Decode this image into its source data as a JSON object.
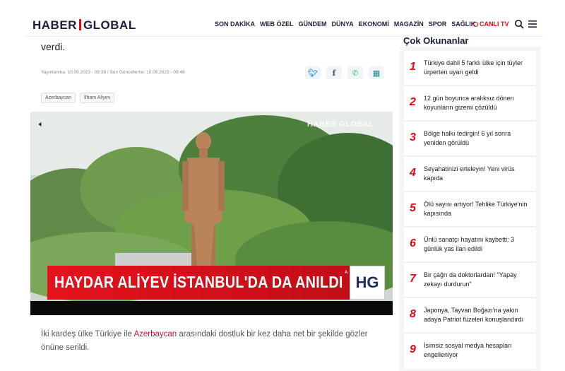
{
  "header": {
    "logo_left": "HABER",
    "logo_right": "GLOBAL",
    "nav": [
      "SON DAKİKA",
      "WEB ÖZEL",
      "GÜNDEM",
      "DÜNYA",
      "EKONOMİ",
      "MAGAZİN",
      "SPOR",
      "SAĞLIK"
    ],
    "live_label": "CANLI TV",
    "icons": [
      "search-icon",
      "menu-icon"
    ]
  },
  "article": {
    "lead_end": "verdi.",
    "meta": "Yayınlanma: 10.05.2023 - 09:38 / Son Güncelleme: 10.05.2023 - 09:46",
    "share_icons": [
      "twitter-icon",
      "facebook-icon",
      "whatsapp-icon",
      "calendar-icon"
    ],
    "tags": [
      "Azerbaycan",
      "İlham Aliyev"
    ],
    "video": {
      "watermark": "HABER GLOBAL",
      "banner": "HAYDAR ALİYEV İSTANBUL'DA DA ANILDI",
      "badge": "HG",
      "badge_small": "A"
    },
    "body_before": "İki kardeş ülke Türkiye ile ",
    "body_link": "Azerbaycan",
    "body_after": " arasındaki dostluk bir kez daha net bir şekilde gözler önüne serildi."
  },
  "sidebar": {
    "title": "Çok Okunanlar",
    "items": [
      {
        "num": "1",
        "text": "Türkiye dahil 5 farklı ülke için tüyler ürperten uyarı geldi"
      },
      {
        "num": "2",
        "text": "12 gün boyunca aralıksız dönen koyunların gizemi çözüldü"
      },
      {
        "num": "3",
        "text": "Bölge halkı tedirgin! 6 yıl sonra yeniden görüldü"
      },
      {
        "num": "4",
        "text": "Seyahatinizi erteleyin! Yeni virüs kapıda"
      },
      {
        "num": "5",
        "text": "Ölü sayısı artıyor! Tehlike Türkiye'nin kapısında"
      },
      {
        "num": "6",
        "text": "Ünlü sanatçı hayatını kaybetti: 3 günlük yas ilan edildi"
      },
      {
        "num": "7",
        "text": "Bir çağrı da doktorlardan! \"Yapay zekayı durdurun\""
      },
      {
        "num": "8",
        "text": "Japonya, Tayvan Boğazı'na yakın adaya Patriot füzeleri konuşlandırdı"
      },
      {
        "num": "9",
        "text": "İsimsiz sosyal medya hesapları engelleniyor"
      }
    ]
  },
  "colors": {
    "brand_red": "#e30613",
    "brand_navy": "#1b1f3a"
  }
}
